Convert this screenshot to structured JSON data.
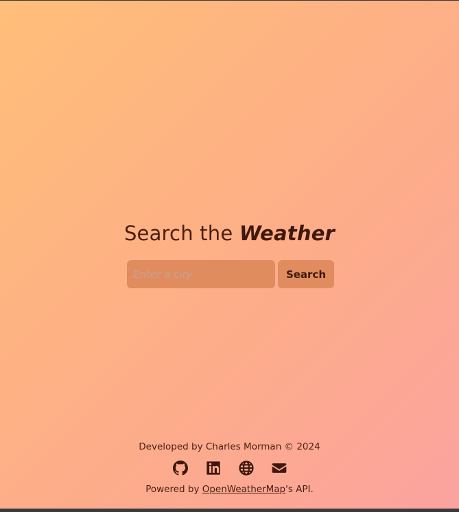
{
  "hero": {
    "title_prefix": "Search the",
    "title_emphasis": "Weather"
  },
  "search": {
    "placeholder": "Enter a city",
    "value": "",
    "button_label": "Search"
  },
  "footer": {
    "developed_by": "Developed by Charles Morman © 2024",
    "icons": [
      "github-icon",
      "linkedin-icon",
      "globe-icon",
      "envelope-icon"
    ],
    "powered_prefix": "Powered by ",
    "powered_link": "OpenWeatherMap",
    "powered_suffix": "'s API."
  },
  "colors": {
    "gradient_start": "#ffbe78",
    "gradient_end": "#fba3a0",
    "control_bg": "#e08c5f",
    "text": "#4a1e10"
  }
}
